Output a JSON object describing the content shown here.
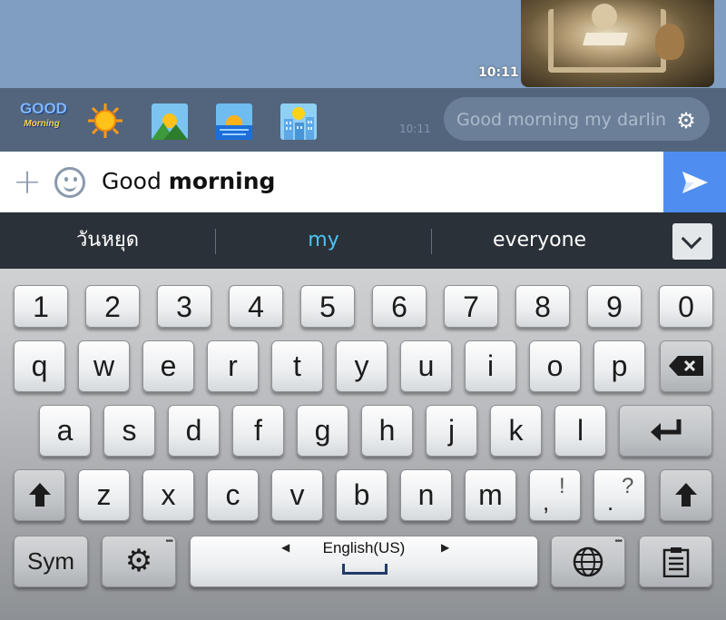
{
  "chat": {
    "photo_time": "10:11",
    "ghost_message": "Good morning my darling",
    "ghost_time": "10:11"
  },
  "stickers": [
    {
      "name": "good-morning-sticker",
      "text_top": "GOOD",
      "text_bottom": "Morning"
    },
    {
      "name": "sun-icon"
    },
    {
      "name": "sunrise-mountains-icon"
    },
    {
      "name": "sunrise-sea-icon"
    },
    {
      "name": "city-sun-icon"
    }
  ],
  "input": {
    "text_plain": "Good ",
    "text_bold": "morning",
    "send_icon": "send-arrow-icon"
  },
  "suggestions": [
    "วันหยุด",
    "my",
    "everyone"
  ],
  "keyboard": {
    "numbers": [
      "1",
      "2",
      "3",
      "4",
      "5",
      "6",
      "7",
      "8",
      "9",
      "0"
    ],
    "row1": [
      "q",
      "w",
      "e",
      "r",
      "t",
      "y",
      "u",
      "i",
      "o",
      "p"
    ],
    "row2": [
      "a",
      "s",
      "d",
      "f",
      "g",
      "h",
      "j",
      "k",
      "l"
    ],
    "row3": [
      "z",
      "x",
      "c",
      "v",
      "b",
      "n",
      "m"
    ],
    "punct1": {
      "main": ",",
      "alt": "!"
    },
    "punct2": {
      "main": ".",
      "alt": "?"
    },
    "sym_label": "Sym",
    "language_label": "English(US)"
  },
  "colors": {
    "chat_bg": "#7f9ec2",
    "send_button": "#4f8ef0",
    "suggestion_highlight": "#4cc3f2"
  }
}
